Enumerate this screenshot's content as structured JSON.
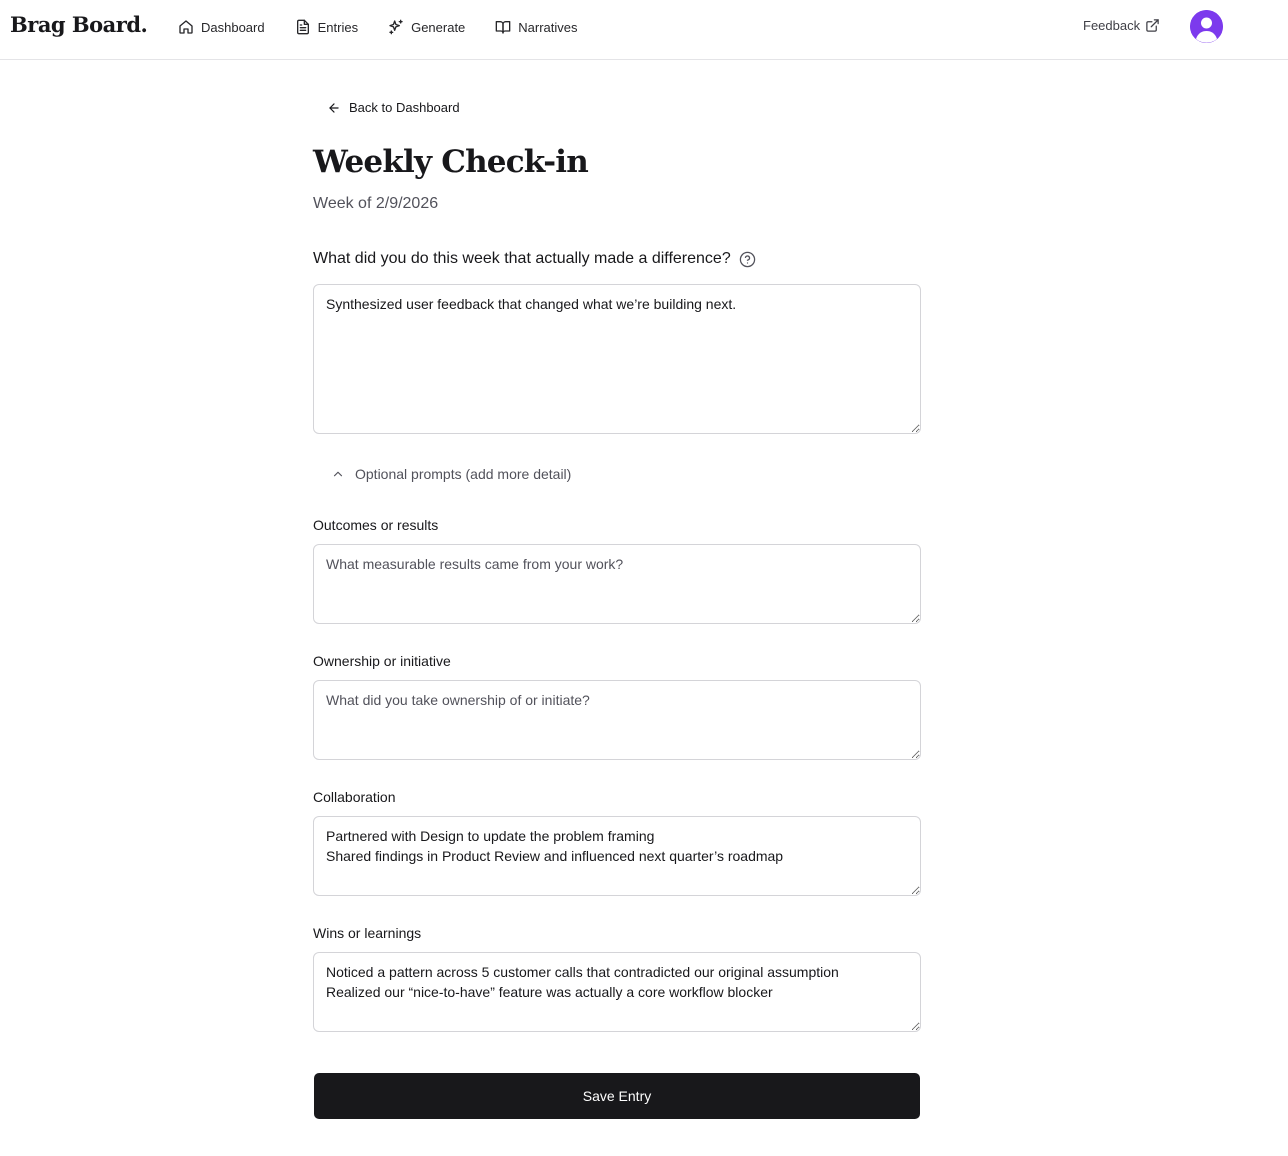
{
  "brand": "Brag Board.",
  "nav": [
    {
      "label": "Dashboard",
      "icon": "home-icon"
    },
    {
      "label": "Entries",
      "icon": "file-text-icon"
    },
    {
      "label": "Generate",
      "icon": "sparkles-icon"
    },
    {
      "label": "Narratives",
      "icon": "book-open-icon"
    }
  ],
  "feedback_label": "Feedback",
  "back_label": "Back to Dashboard",
  "title": "Weekly Check-in",
  "subtitle": "Week of 2/9/2026",
  "question": "What did you do this week that actually made a difference?",
  "main_answer": "Synthesized user feedback that changed what we’re building next.",
  "optional_toggle": "Optional prompts (add more detail)",
  "fields": [
    {
      "label": "Outcomes or results",
      "placeholder": "What measurable results came from your work?",
      "value": ""
    },
    {
      "label": "Ownership or initiative",
      "placeholder": "What did you take ownership of or initiate?",
      "value": ""
    },
    {
      "label": "Collaboration",
      "placeholder": "",
      "value": "Partnered with Design to update the problem framing\nShared findings in Product Review and influenced next quarter’s roadmap"
    },
    {
      "label": "Wins or learnings",
      "placeholder": "",
      "value": "Noticed a pattern across 5 customer calls that contradicted our original assumption\nRealized our “nice-to-have” feature was actually a core workflow blocker"
    }
  ],
  "save_label": "Save Entry",
  "colors": {
    "primary": "#18181b",
    "avatar": "#7c3aed",
    "border": "#d4d4d8",
    "muted": "#52525b"
  }
}
